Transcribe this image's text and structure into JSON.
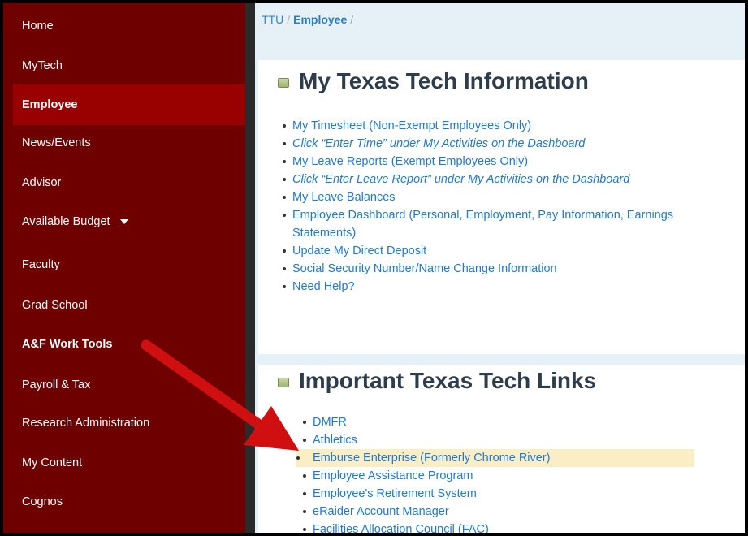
{
  "sidebar": {
    "items": [
      {
        "label": "Home"
      },
      {
        "label": "MyTech"
      },
      {
        "label": "Employee"
      },
      {
        "label": "News/Events"
      },
      {
        "label": "Advisor"
      },
      {
        "label": "Available Budget"
      },
      {
        "label": "Faculty"
      },
      {
        "label": "Grad School"
      },
      {
        "label": "A&F Work Tools"
      },
      {
        "label": "Payroll & Tax"
      },
      {
        "label": "Research Administration"
      },
      {
        "label": "My Content"
      },
      {
        "label": "Cognos"
      }
    ]
  },
  "breadcrumb": {
    "root": "TTU",
    "current": "Employee"
  },
  "section1": {
    "title": "My Texas Tech Information",
    "items": [
      {
        "label": "My Timesheet (Non-Exempt Employees Only)",
        "sub": "Click “Enter Time” under My Activities on the Dashboard"
      },
      {
        "label": "My Leave Reports (Exempt Employees Only)",
        "sub": "Click “Enter Leave Report” under My Activities on the Dashboard"
      },
      {
        "label": "My Leave Balances"
      },
      {
        "label": "Employee Dashboard (Personal, Employment, Pay Information, Earnings Statements)"
      },
      {
        "label": "Update My Direct Deposit"
      },
      {
        "label": "Social Security Number/Name Change Information"
      },
      {
        "label": "Need Help?"
      }
    ]
  },
  "section2": {
    "title": "Important Texas Tech Links",
    "items": [
      {
        "label": "DMFR"
      },
      {
        "label": "Athletics"
      },
      {
        "label": "Emburse Enterprise (Formerly Chrome River)"
      },
      {
        "label": "Employee Assistance Program"
      },
      {
        "label": "Employee's Retirement System"
      },
      {
        "label": "eRaider Account Manager"
      },
      {
        "label": "Facilities Allocation Council (FAC)"
      }
    ]
  },
  "colors": {
    "sidebar": "#6e0000",
    "active": "#990000",
    "link": "#2178d6",
    "arrow": "#d01010",
    "highlight": "#faefc4"
  }
}
